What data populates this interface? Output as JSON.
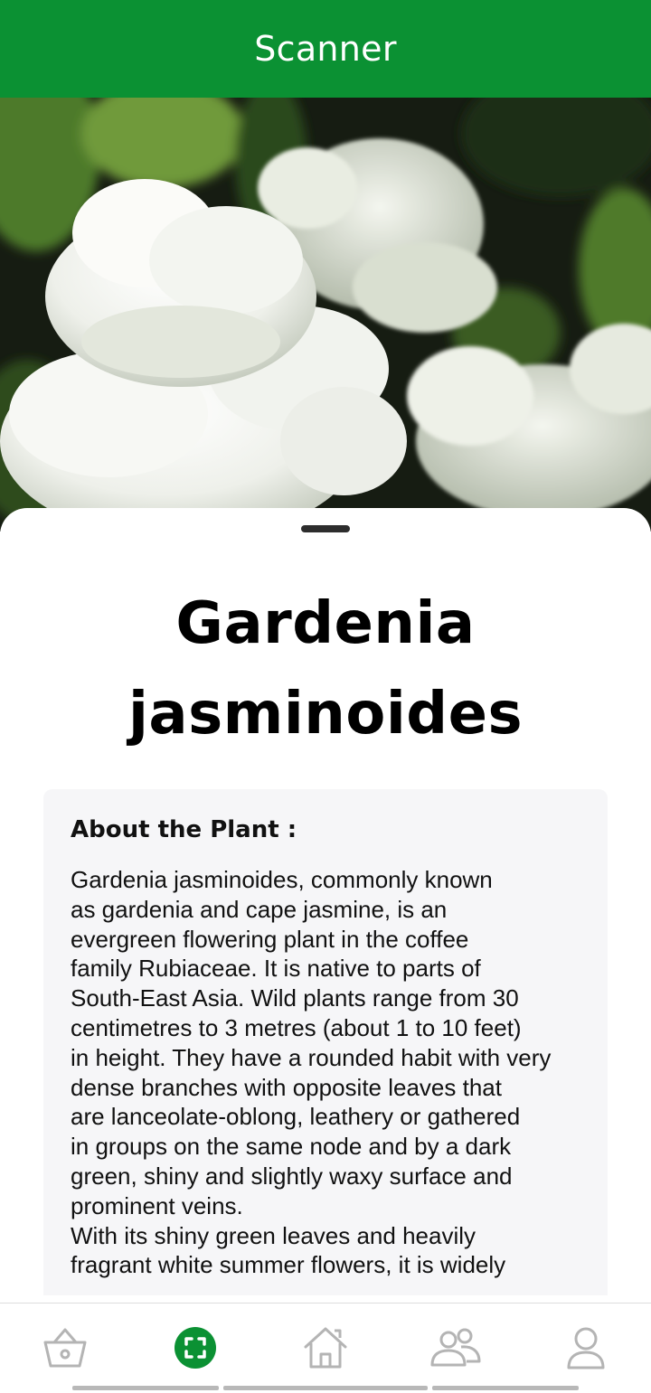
{
  "header": {
    "title": "Scanner",
    "background_color": "#0b9133"
  },
  "hero_image": {
    "subject": "white gardenia flowers with green leaves",
    "icon": "photo"
  },
  "plant": {
    "name_line1": "Gardenia",
    "name_line2": "jasminoides"
  },
  "about": {
    "heading": "About the Plant :",
    "lines": [
      "Gardenia jasminoides, commonly known",
      "as gardenia and cape jasmine, is an",
      "evergreen flowering plant in the coffee",
      "family Rubiaceae. It is native to parts of",
      "South-East Asia. Wild plants range from 30",
      "centimetres to 3 metres (about 1 to 10 feet)",
      "in height. They have a rounded habit with very",
      "dense branches with opposite leaves that",
      "are lanceolate-oblong, leathery or gathered",
      "in groups on the same node and by a dark",
      "green, shiny and slightly waxy surface and",
      "prominent veins.",
      "With its shiny green leaves and heavily",
      "fragrant white summer flowers, it is widely"
    ]
  },
  "bottom_nav": {
    "items": [
      {
        "icon": "basket-icon",
        "active": false
      },
      {
        "icon": "scan-icon",
        "active": true
      },
      {
        "icon": "home-icon",
        "active": false
      },
      {
        "icon": "community-icon",
        "active": false
      },
      {
        "icon": "profile-icon",
        "active": false
      }
    ],
    "active_color": "#0b9133",
    "inactive_color": "#b4b4b4"
  }
}
